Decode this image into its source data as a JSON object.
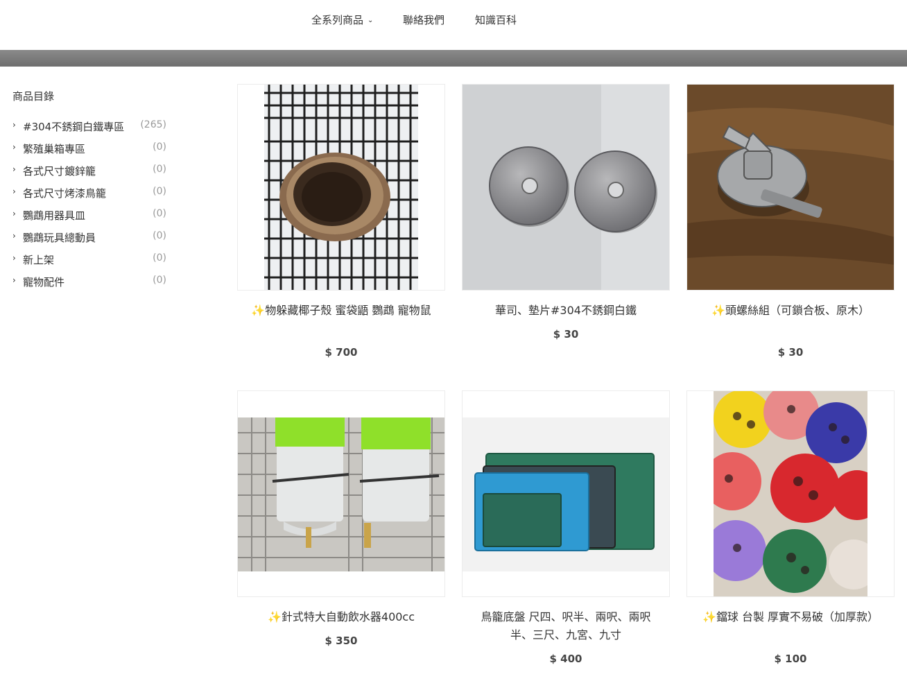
{
  "nav": {
    "items": [
      {
        "label": "全系列商品"
      },
      {
        "label": "聯絡我們"
      },
      {
        "label": "知識百科"
      }
    ],
    "dropdown_icon": "chevron-down-icon"
  },
  "sidebar": {
    "title": "商品目錄",
    "categories": [
      {
        "label": "#304不銹鋼白鐵專區",
        "count": "(265)"
      },
      {
        "label": "繁殖巢箱專區",
        "count": "(0)"
      },
      {
        "label": "各式尺寸鍍鋅籠",
        "count": "(0)"
      },
      {
        "label": "各式尺寸烤漆鳥籠",
        "count": "(0)"
      },
      {
        "label": "鸚鵡用器具皿",
        "count": "(0)"
      },
      {
        "label": "鸚鵡玩具總動員",
        "count": "(0)"
      },
      {
        "label": "新上架",
        "count": "(0)"
      },
      {
        "label": "寵物配件",
        "count": "(0)"
      }
    ]
  },
  "products": [
    {
      "name": "✨寵物躲藏椰子殼 蜜袋鼯 鸚鵡 寵物鼠",
      "price": "$ 700"
    },
    {
      "name": "華司、墊片#304不銹鋼白鐵",
      "price": "$ 30"
    },
    {
      "name": "✨雙頭螺絲組（可鎖合板、原木）",
      "price": "$ 30"
    },
    {
      "name": "✨撞針式特大自動飲水器400cc",
      "price": "$ 350"
    },
    {
      "name": "鳥籠底盤 尺四、呎半、兩呎、兩呎半、三尺、九宮、九寸",
      "price": "$ 400"
    },
    {
      "name": "✨鈴鐺球 台製 厚實不易破（加厚款）",
      "price": "$ 100"
    }
  ],
  "colors": {
    "banner": "#7a7a7a",
    "sparkle": "#f5b400",
    "count_text": "#999999"
  }
}
